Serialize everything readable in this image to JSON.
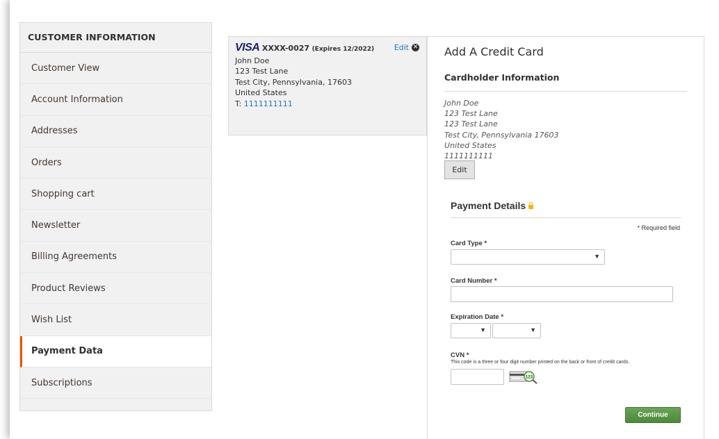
{
  "sidebar": {
    "title": "CUSTOMER INFORMATION",
    "items": [
      {
        "label": "Customer View"
      },
      {
        "label": "Account Information"
      },
      {
        "label": "Addresses"
      },
      {
        "label": "Orders"
      },
      {
        "label": "Shopping cart"
      },
      {
        "label": "Newsletter"
      },
      {
        "label": "Billing Agreements"
      },
      {
        "label": "Product Reviews"
      },
      {
        "label": "Wish List"
      },
      {
        "label": "Payment Data",
        "active": true
      },
      {
        "label": "Subscriptions"
      }
    ]
  },
  "saved_card": {
    "brand": "VISA",
    "masked_number": "XXXX-0027",
    "expires": "(Expires 12/2022)",
    "edit_label": "Edit",
    "name": "John Doe",
    "street": "123 Test Lane",
    "city_line": "Test City, Pennsylvania, 17603",
    "country": "United States",
    "phone_prefix": "T: ",
    "phone": "1111111111"
  },
  "form": {
    "title": "Add A Credit Card",
    "cardholder_title": "Cardholder Information",
    "address_lines": [
      "John Doe",
      "123 Test Lane",
      "123 Test Lane",
      "Test City, Pennsylvania 17603",
      "United States",
      "1111111111"
    ],
    "edit_button": "Edit",
    "payment_title": "Payment Details",
    "required_note": "* Required field",
    "card_type_label": "Card Type *",
    "card_number_label": "Card Number *",
    "expiration_label": "Expiration Date *",
    "cvn_label": "CVN *",
    "cvn_help": "This code is a three or four digit number printed on the back or front of credit cards.",
    "cvv_icon_text": "123",
    "continue_button": "Continue"
  },
  "colors": {
    "accent": "#eb5202",
    "link": "#1979c3",
    "continue": "#5a963f"
  }
}
